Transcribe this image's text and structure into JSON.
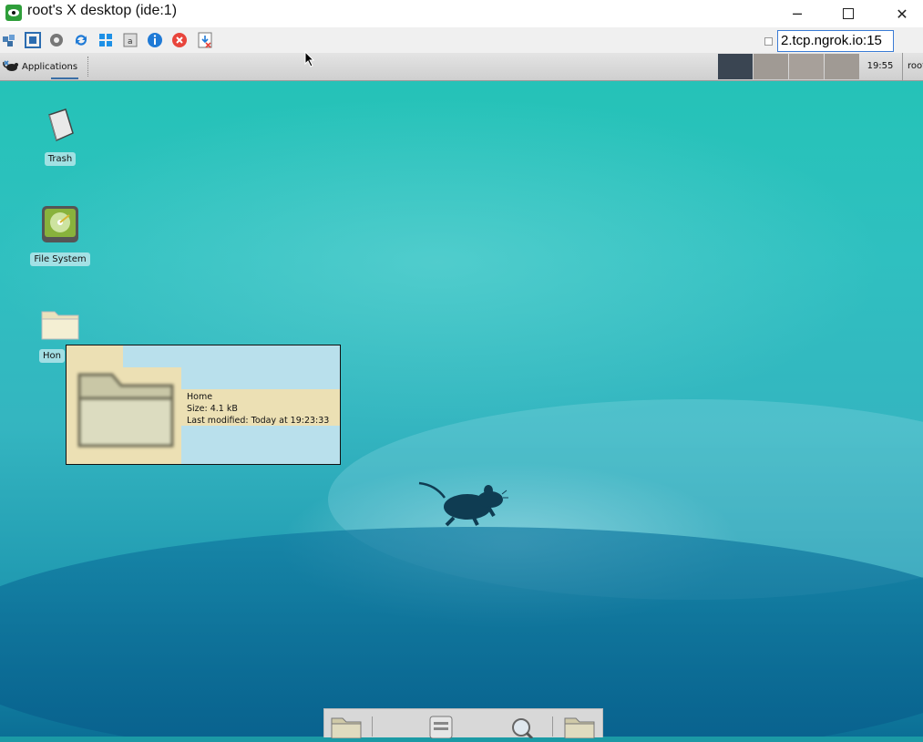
{
  "window": {
    "title": "root's X desktop (ide:1)",
    "app_icon": "eye-icon",
    "controls": [
      "minimize-icon",
      "maximize-icon",
      "close-icon"
    ]
  },
  "toolbar": {
    "icons": [
      "network-options-icon",
      "fullscreen-icon",
      "settings-icon",
      "refresh-icon",
      "windows-key-icon",
      "ctrl-alt-del-icon",
      "info-icon",
      "disconnect-icon",
      "file-transfer-icon"
    ],
    "address": "2.tcp.ngrok.io:15"
  },
  "panel": {
    "applications_label": "Applications",
    "clock": "19:55",
    "user": "root"
  },
  "desktop": {
    "icons": [
      {
        "label": "Trash"
      },
      {
        "label": "File System"
      },
      {
        "label": "Hon"
      }
    ]
  },
  "tooltip": {
    "name": "Home",
    "size": "Size: 4.1 kB",
    "modified": "Last modified: Today at 19:23:33"
  },
  "dock": {
    "icons": [
      "folder-icon",
      "file-manager-icon",
      "search-icon",
      "folder-icon"
    ]
  },
  "colors": {
    "desktop_top": "#23c3b6",
    "desktop_bottom": "#0b6f96",
    "tooltip_bg": "#b9e0ec",
    "tooltip_highlight": "#ece0b4"
  }
}
